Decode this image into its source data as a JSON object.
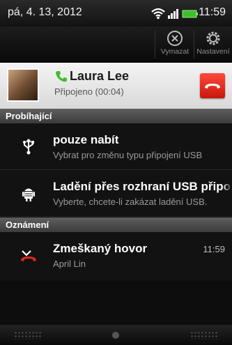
{
  "statusbar": {
    "date": "pá, 4. 13, 2012",
    "time": "11:59",
    "icons": [
      "wifi-icon",
      "signal-icon",
      "battery-icon"
    ]
  },
  "actions": [
    {
      "label": "Vymazat",
      "icon": "clear-icon"
    },
    {
      "label": "Nastavení",
      "icon": "settings-icon"
    }
  ],
  "ongoing_call": {
    "name": "Laura Lee",
    "status": "Připojeno (00:04)",
    "icon": "phone-icon",
    "end_icon": "end-call-icon"
  },
  "sections": {
    "ongoing": "Probíhající",
    "notifications": "Oznámení"
  },
  "ongoing_items": [
    {
      "title": "pouze nabít",
      "subtitle": "Vybrat pro změnu typu připojení USB",
      "icon": "usb-icon"
    },
    {
      "title": "Ladění přes rozhraní USB připo",
      "subtitle": "Vyberte, chcete-li zakázat ladění USB.",
      "icon": "android-debug-icon"
    }
  ],
  "notifications": [
    {
      "title": "Zmeškaný hovor",
      "subtitle": "April Lin",
      "time": "11:59",
      "icon": "missed-call-icon"
    }
  ],
  "colors": {
    "accent_green": "#4ccd2b",
    "end_call_red": "#e0281a",
    "section_bg": "#4a4a4a"
  }
}
